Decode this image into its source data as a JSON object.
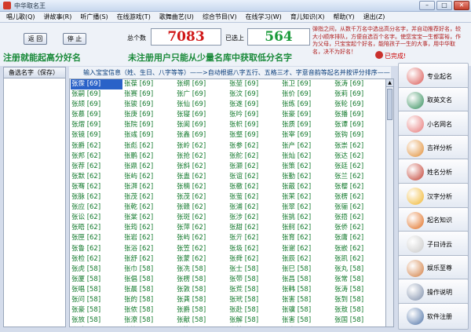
{
  "window": {
    "title": "中华取名王"
  },
  "menu": [
    "唱儿歌(Q)",
    "讲故事(R)",
    "听广播(S)",
    "在线游戏(T)",
    "歌舞曲艺(U)",
    "综合节目(V)",
    "在线学习(W)",
    "育儿知识(X)",
    "帮助(Y)",
    "退出(Z)"
  ],
  "controls": {
    "back": "返 回",
    "stop": "停 止"
  },
  "stats": {
    "total_label": "总个数",
    "total": "7083",
    "selected_label": "已选上",
    "selected": "564"
  },
  "slogans": {
    "left": "注册就能起高分好名",
    "right": "未注册用户只能从少量名库中获取低分名字"
  },
  "tips": "弹指之间，从数千万名中选出高分名字，并自动推荐好名，较大小顺序排队，方便自选百个名字。使您宝宝一生都富裕，作为父母，只宝宝起个好名，能陪孩子一生的大事，用中华取名，决不为好名！",
  "status": {
    "done": "已完成!"
  },
  "left_panel": {
    "header": "备选名字（保存）"
  },
  "grid": {
    "instruction": "输入宝宝信息（姓、生日、八字等等）——>自动根据八字五行、五格三才、字意音韵等起名并按评分排序——",
    "columns": [
      [
        "张霂 [69]",
        "张嗣 [69]",
        "张颉 [69]",
        "张慕 [69]",
        "张熠 [69]",
        "张镜 [69]",
        "张爵 [62]",
        "张邦 [62]",
        "张荐 [62]",
        "张默 [62]",
        "张骞 [62]",
        "张脉 [62]",
        "张应 [62]",
        "张讼 [62]",
        "张晤 [62]",
        "张匣 [62]",
        "张鲁 [62]",
        "张检 [62]",
        "张虎 [58]",
        "张厦 [58]",
        "张唱 [58]",
        "张问 [58]",
        "张豪 [58]",
        "张放 [58]",
        "张醉 [58]"
      ],
      [
        "张葆 [69]",
        "张赛 [69]",
        "张骏 [69]",
        "张庚 [69]",
        "张院 [69]",
        "张彧 [69]",
        "张彪 [62]",
        "张鹏 [62]",
        "张鼎 [62]",
        "张屿 [62]",
        "张湃 [62]",
        "张茂 [62]",
        "张乾 [62]",
        "张棠 [62]",
        "张筠 [62]",
        "张岩 [62]",
        "张浴 [62]",
        "张舒 [62]",
        "张巾 [58]",
        "张倡 [58]",
        "张晨 [58]",
        "张的 [58]",
        "张侬 [58]",
        "张潦 [58]",
        "张洛 [58]"
      ],
      [
        "张纲 [69]",
        "张广 [69]",
        "张仙 [69]",
        "张寝 [69]",
        "张阆 [69]",
        "张鑫 [69]",
        "张岭 [62]",
        "张抢 [62]",
        "张斜 [62]",
        "张蛊 [62]",
        "张楠 [62]",
        "张茂 [62]",
        "张赣 [62]",
        "张斑 [62]",
        "张萍 [62]",
        "张屿 [62]",
        "张笠 [62]",
        "张蒙 [62]",
        "张冼 [58]",
        "张楞 [58]",
        "张敦 [58]",
        "张龚 [58]",
        "张爵 [58]",
        "张献 [58]",
        "张柒 [58]"
      ],
      [
        "张堃 [69]",
        "张汶 [69]",
        "张遂 [69]",
        "张吟 [69]",
        "张帜 [69]",
        "张壑 [69]",
        "张参 [62]",
        "张舵 [62]",
        "张灏 [62]",
        "张谊 [62]",
        "张檄 [62]",
        "张萤 [62]",
        "张浦 [62]",
        "张涉 [62]",
        "张甜 [62]",
        "张亓 [62]",
        "张圾 [62]",
        "张舜 [62]",
        "张士 [58]",
        "张带 [58]",
        "张荒 [58]",
        "张玳 [58]",
        "张赴 [58]",
        "张解 [58]",
        "张舶 [58]"
      ],
      [
        "张卫 [69]",
        "张价 [69]",
        "张练 [69]",
        "张豪 [69]",
        "张质 [69]",
        "张宰 [69]",
        "张产 [62]",
        "张灿 [62]",
        "张策 [62]",
        "张勤 [62]",
        "张蔽 [62]",
        "张茉 [62]",
        "张翠 [62]",
        "张挑 [62]",
        "张舸 [62]",
        "张育 [62]",
        "张谢 [62]",
        "张辰 [62]",
        "张巳 [58]",
        "张昌 [58]",
        "张韩 [58]",
        "张害 [58]",
        "张骥 [58]",
        "张害 [58]",
        "张许 [58]"
      ],
      [
        "张涛 [69]",
        "张莉 [69]",
        "张轮 [69]",
        "张播 [69]",
        "张谭 [69]",
        "张钩 [69]",
        "张崇 [62]",
        "张达 [62]",
        "张廷 [62]",
        "张兰 [62]",
        "张樱 [62]",
        "张楞 [62]",
        "张骊 [62]",
        "张捂 [62]",
        "张侨 [62]",
        "张庸 [62]",
        "张嵌 [62]",
        "张凯 [62]",
        "张丸 [58]",
        "张常 [58]",
        "张涛 [58]",
        "张到 [58]",
        "张敖 [58]",
        "张国 [58]",
        "张国 [58]"
      ]
    ]
  },
  "sidebar": [
    "专业起名",
    "取英文名",
    "小名网名",
    "吉祥分析",
    "姓名分析",
    "汉字分析",
    "起名知识",
    "子曰诗云",
    "娱乐至尊",
    "操作说明",
    "软件注册"
  ],
  "colors": {
    "name_text": "#137a2d",
    "slogan": "#1a8a3a",
    "total": "#d01818",
    "selected": "#1a9a3a",
    "selection": "#2a62c8"
  }
}
